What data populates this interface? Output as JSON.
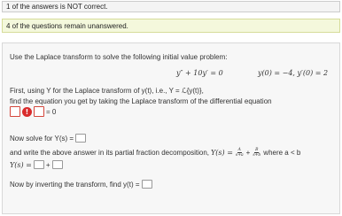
{
  "banners": {
    "incorrect": "1 of the answers is NOT correct.",
    "unanswered": "4 of the questions remain unanswered."
  },
  "problem": {
    "intro": "Use the Laplace transform to solve the following initial value problem:",
    "equation": "y″ + 10y′ = 0",
    "initial_conditions": "y(0) = −4,  y′(0) = 2",
    "step1_text": "First, using Y for the Laplace transform of y(t), i.e., Y = ℒ{y(t)},",
    "step1_text2": "find the equation you get by taking the Laplace transform of the differential equation",
    "step1_equals": "= 0",
    "step2_prefix": "Now solve for Y(s) =",
    "step3_text": "and write the above answer in its partial fraction decomposition,",
    "step3_formula_lhs": "Y(s) =",
    "step3_frac_a_num": "A",
    "step3_frac_a_den": "s+a",
    "step3_plus": "+",
    "step3_frac_b_num": "B",
    "step3_frac_b_den": "s+b",
    "step3_where": "where a < b",
    "step3_lhs2": "Y(s) =",
    "step3_plus2": "+",
    "step4_prefix": "Now by inverting the transform, find y(t) ="
  },
  "icons": {
    "error_badge_symbol": "!"
  }
}
